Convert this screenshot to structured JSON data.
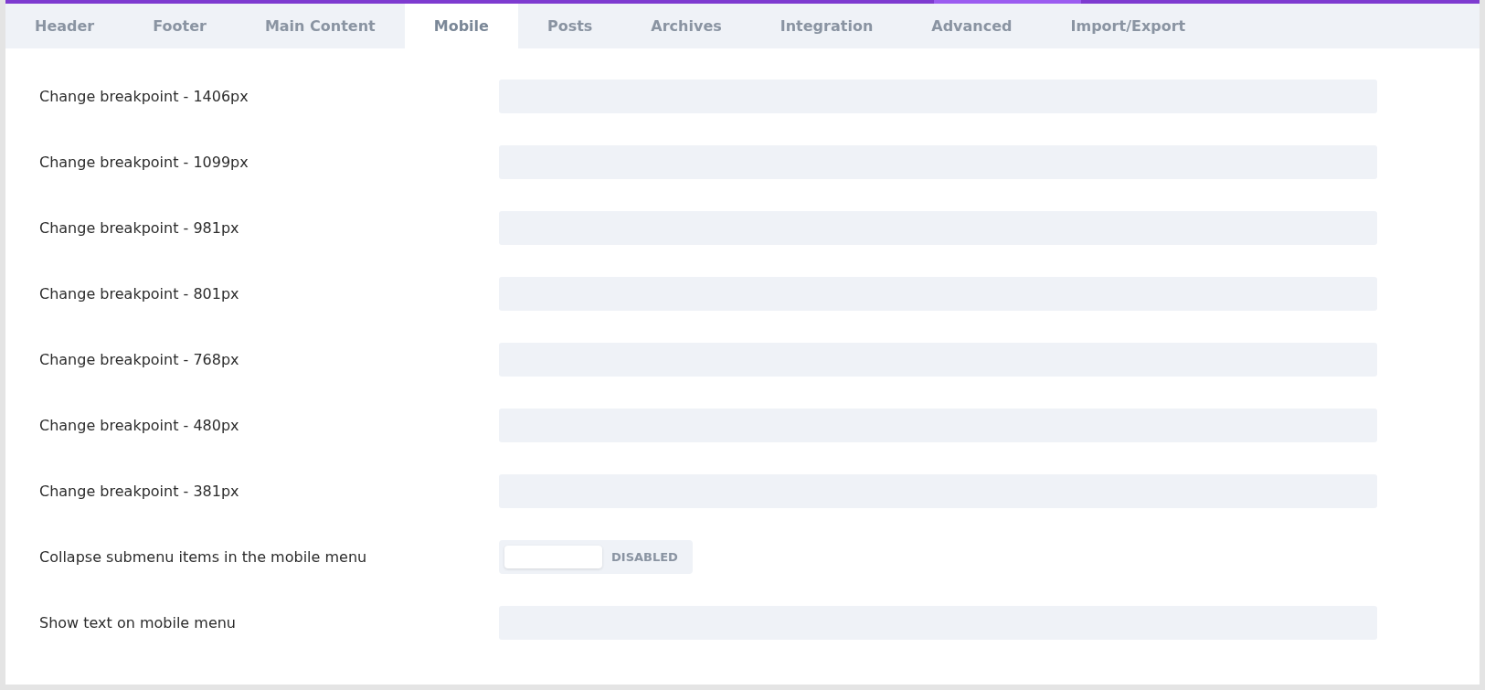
{
  "tabs": [
    {
      "label": "Header",
      "selected": false
    },
    {
      "label": "Footer",
      "selected": false
    },
    {
      "label": "Main Content",
      "selected": false
    },
    {
      "label": "Mobile",
      "selected": true
    },
    {
      "label": "Posts",
      "selected": false
    },
    {
      "label": "Archives",
      "selected": false
    },
    {
      "label": "Integration",
      "selected": false
    },
    {
      "label": "Advanced",
      "selected": false
    },
    {
      "label": "Import/Export",
      "selected": false
    }
  ],
  "settings": [
    {
      "kind": "text",
      "label": "Change breakpoint - 1406px"
    },
    {
      "kind": "text",
      "label": "Change breakpoint - 1099px"
    },
    {
      "kind": "text",
      "label": "Change breakpoint - 981px"
    },
    {
      "kind": "text",
      "label": "Change breakpoint - 801px"
    },
    {
      "kind": "text",
      "label": "Change breakpoint - 768px"
    },
    {
      "kind": "text",
      "label": "Change breakpoint - 480px"
    },
    {
      "kind": "text",
      "label": "Change breakpoint - 381px"
    },
    {
      "kind": "toggle",
      "label": "Collapse submenu items in the mobile menu",
      "on": false,
      "state_label": "DISABLED"
    },
    {
      "kind": "text",
      "label": "Show text on mobile menu"
    }
  ]
}
